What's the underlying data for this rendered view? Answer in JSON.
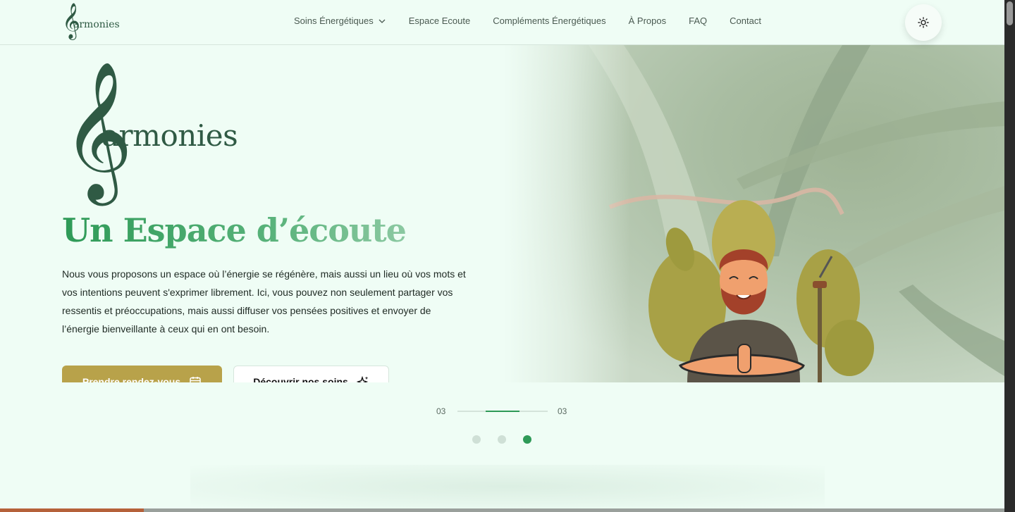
{
  "header": {
    "logo_word": "armonies",
    "logo_clef": "𝄞",
    "nav": [
      {
        "label": "Soins Énergétiques",
        "has_dropdown": true
      },
      {
        "label": "Espace Ecoute"
      },
      {
        "label": "Compléments Énergétiques"
      },
      {
        "label": "À Propos"
      },
      {
        "label": "FAQ"
      },
      {
        "label": "Contact"
      }
    ],
    "theme_icon": "sun-icon"
  },
  "hero": {
    "logo_clef": "𝄞",
    "logo_word": "armonies",
    "title": "Un Espace d’écoute",
    "text": "Nous vous proposons un espace où l’énergie se régénère, mais aussi un lieu où vos mots et vos intentions peuvent s'exprimer librement. Ici, vous pouvez non seulement partager vos ressentis et préoccupations, mais aussi diffuser vos pensées positives et envoyer de l’énergie bienveillante à ceux qui en ont besoin.",
    "primary_button": "Prendre rendez-vous",
    "secondary_button": "Découvrir nos soins",
    "image_description_icon": "meditating-man-illustration"
  },
  "slider": {
    "current": "03",
    "total": "03",
    "progress": 0.375,
    "dots": 3,
    "active_dot": 3
  },
  "page_progress": 0.143,
  "colors": {
    "accent": "#2e9a57",
    "brand_dark": "#2f5a44",
    "primary_button": "#b8a24a",
    "background": "#effdf5"
  }
}
